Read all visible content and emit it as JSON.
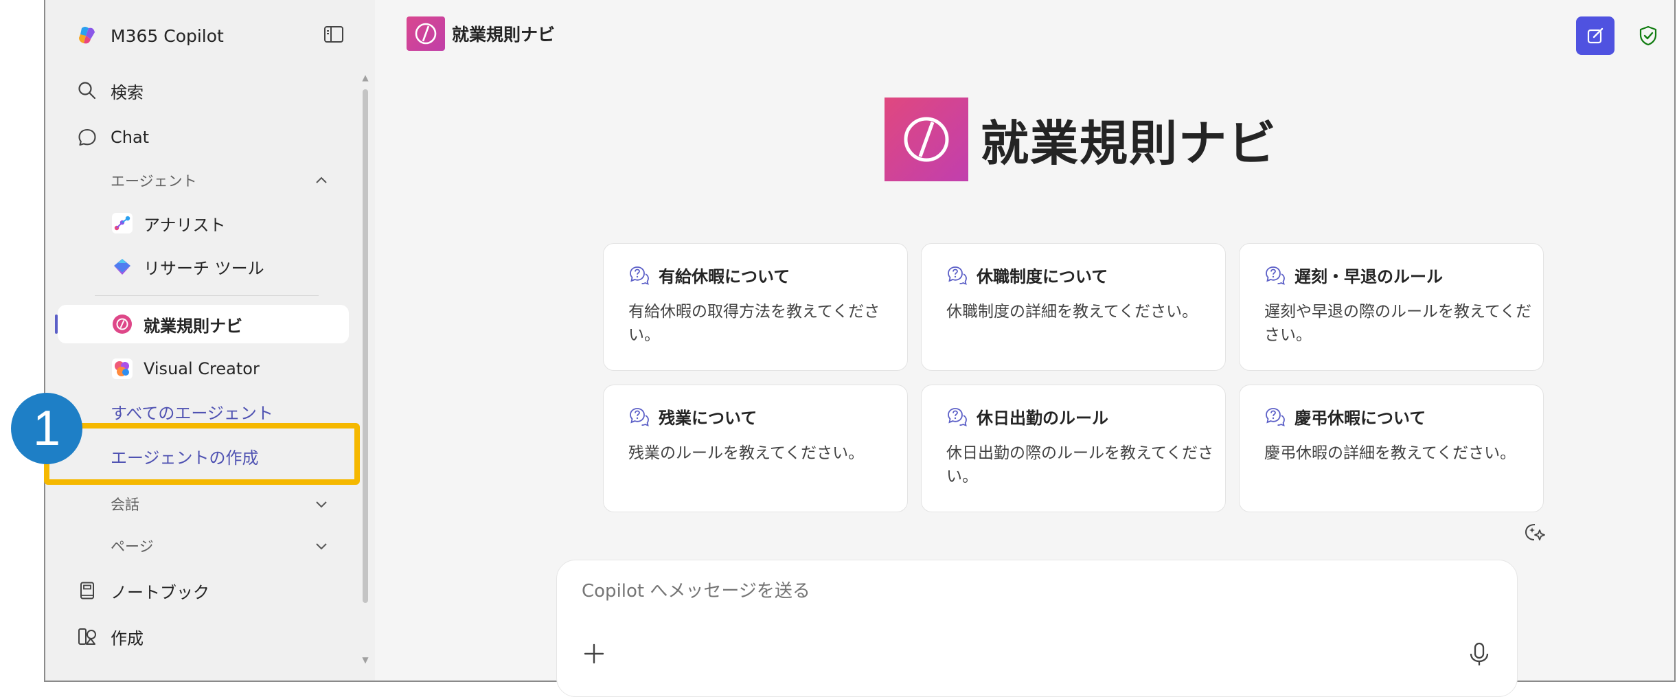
{
  "app": {
    "title": "M365 Copilot"
  },
  "nav": {
    "search": "検索",
    "chat": "Chat",
    "agents_section": "エージェント",
    "agents": [
      {
        "label": "アナリスト"
      },
      {
        "label": "リサーチ ツール"
      },
      {
        "label": "就業規則ナビ",
        "active": true
      },
      {
        "label": "Visual Creator"
      }
    ],
    "all_agents": "すべてのエージェント",
    "create_agent": "エージェントの作成",
    "conversations": "会話",
    "pages": "ページ",
    "notebook": "ノートブック",
    "create": "作成"
  },
  "callout": {
    "number": "1",
    "color": "#1e7fc6",
    "highlight_color": "#f5b800"
  },
  "agent": {
    "name": "就業規則ナビ"
  },
  "prompts": [
    {
      "title": "有給休暇について",
      "body": "有給休暇の取得方法を教えてください。"
    },
    {
      "title": "休職制度について",
      "body": "休職制度の詳細を教えてください。"
    },
    {
      "title": "遅刻・早退のルール",
      "body": "遅刻や早退の際のルールを教えてください。"
    },
    {
      "title": "残業について",
      "body": "残業のルールを教えてください。"
    },
    {
      "title": "休日出勤のルール",
      "body": "休日出勤の際のルールを教えてください。"
    },
    {
      "title": "慶弔休暇について",
      "body": "慶弔休暇の詳細を教えてください。"
    }
  ],
  "composer": {
    "placeholder": "Copilot へメッセージを送る"
  },
  "colors": {
    "accent": "#5b5fc7",
    "link": "#4f52b2",
    "shield": "#107c10"
  }
}
